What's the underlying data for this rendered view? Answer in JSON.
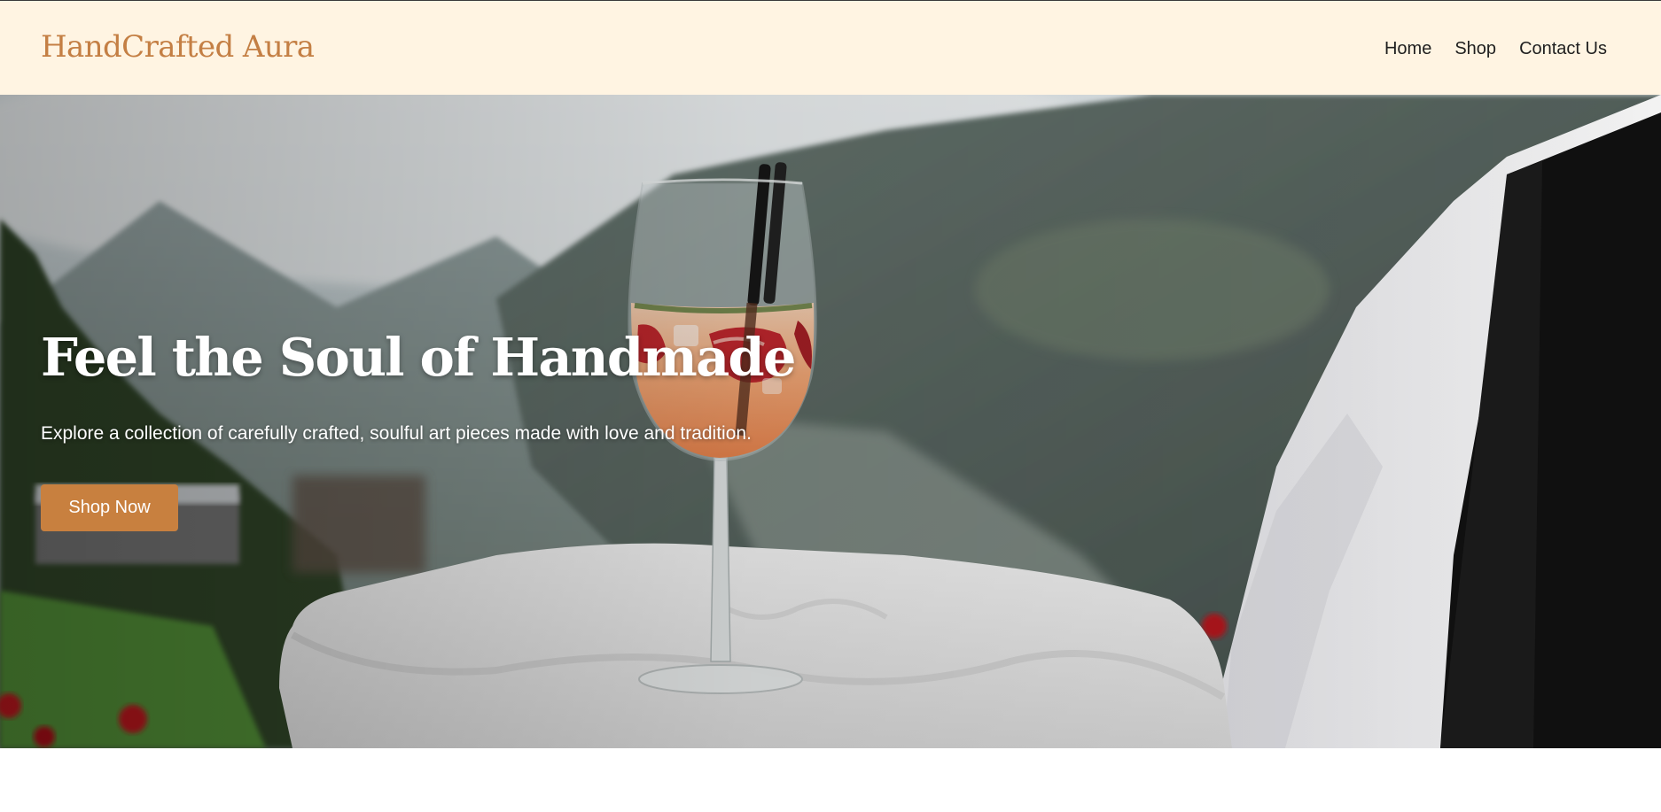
{
  "header": {
    "brand": "HandCrafted Aura",
    "nav": [
      {
        "label": "Home"
      },
      {
        "label": "Shop"
      },
      {
        "label": "Contact Us"
      }
    ]
  },
  "hero": {
    "title": "Feel the Soul of Handmade",
    "subtitle": "Explore a collection of carefully crafted, soulful art pieces made with love and tradition.",
    "cta_label": "Shop Now",
    "image_alt": "Waiter holding a tray with a glass of strawberry spritz in front of mountains"
  },
  "colors": {
    "header_bg": "#fff4e2",
    "brand": "#c47f44",
    "cta_bg": "#c8803f",
    "nav_text": "#1f1f1f",
    "hero_text": "#ffffff"
  }
}
